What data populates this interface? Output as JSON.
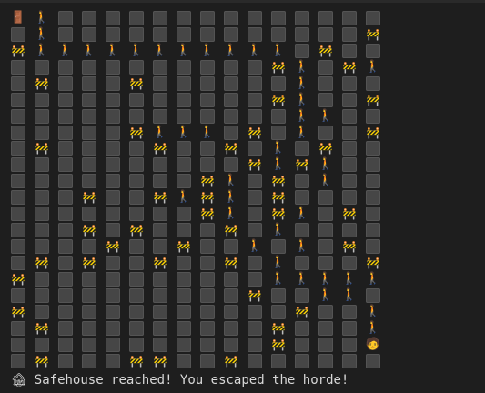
{
  "rows": [
    "SP..............",
    ".P.............B",
    "BPPPPPPPPPPP.B..",
    "...........BP.BP",
    ".B...B......P...",
    "...........BP..B",
    "............PP..",
    ".....BPPP.B.P..B",
    ".B....B..B.P.B..",
    "..........BPBP..",
    "........BP.B.P..",
    "...B..BPBP.B....",
    "........BP.BP.B.",
    "...B.B...B.P....",
    "....B..B..P.P.B.",
    ".B.B..B..B.P...B",
    "B..........PPPPP",
    "..........B..PP.",
    "B...........B..P",
    ".B.........B...P",
    "...........B...E",
    ".B...BB..B......"
  ],
  "symbols": {
    "start_icon": "🚪",
    "path_icon": "🚶",
    "barrier_icon": "🚧",
    "end_icon": "🧑"
  },
  "status": {
    "icon": "🏚",
    "message": "Safehouse reached! You escaped the horde!"
  }
}
